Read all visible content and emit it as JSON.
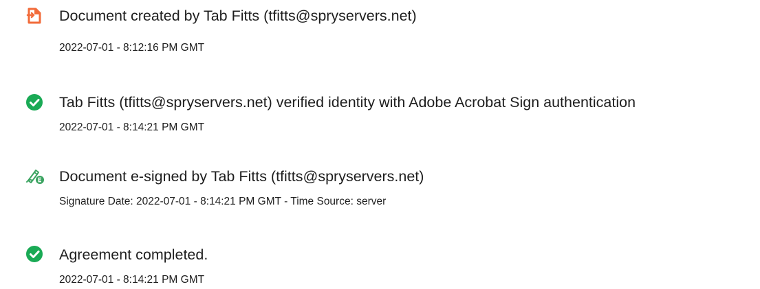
{
  "events": [
    {
      "icon": "document-created-icon",
      "title": "Document created by Tab Fitts (tfitts@spryservers.net)",
      "detail": "2022-07-01 - 8:12:16 PM GMT"
    },
    {
      "icon": "verified-check-icon",
      "title": "Tab Fitts (tfitts@spryservers.net) verified identity with Adobe Acrobat Sign authentication",
      "detail": "2022-07-01 - 8:14:21 PM GMT"
    },
    {
      "icon": "e-signed-pen-icon",
      "title": "Document e-signed by Tab Fitts (tfitts@spryservers.net)",
      "detail": "Signature Date: 2022-07-01 - 8:14:21 PM GMT - Time Source: server"
    },
    {
      "icon": "completed-check-icon",
      "title": "Agreement completed.",
      "detail": "2022-07-01 - 8:14:21 PM GMT"
    }
  ],
  "colors": {
    "document_icon": "#f26b3a",
    "check_icon": "#1aaa55",
    "pen_icon": "#3aa360",
    "text": "#1e1e1e"
  }
}
